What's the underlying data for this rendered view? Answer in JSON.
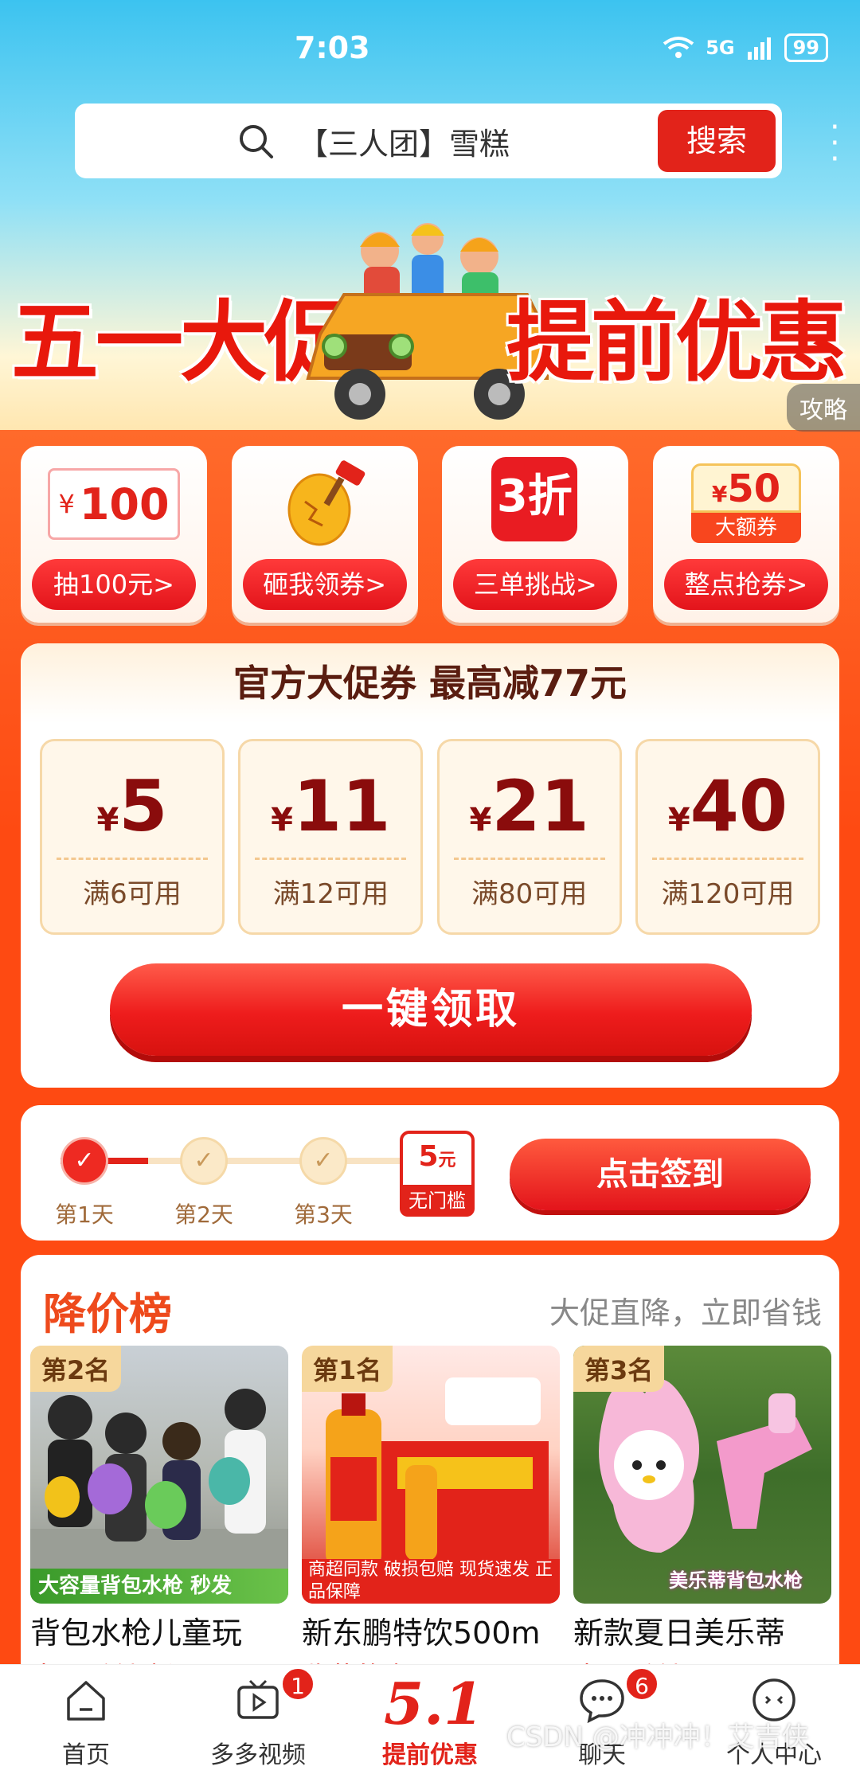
{
  "status_bar": {
    "time": "7:03",
    "signal": "5G",
    "battery": "99"
  },
  "search": {
    "query": "【三人团】雪糕",
    "button": "搜索"
  },
  "banner": {
    "left_text": "五一大促",
    "right_text": "提前优惠",
    "strategy_label": "攻略"
  },
  "features": [
    {
      "label": "抽100元>",
      "icon_amount": "100",
      "icon_currency": "¥"
    },
    {
      "label": "砸我领券>",
      "icon": "golden-egg-hammer-icon"
    },
    {
      "label": "三单挑战>",
      "icon_text": "3折"
    },
    {
      "label": "整点抢券>",
      "icon_amount": "50",
      "icon_currency": "¥",
      "icon_sub": "大额券"
    }
  ],
  "coupon_panel": {
    "title": "官方大促券 最高减77元",
    "coupons": [
      {
        "currency": "¥",
        "amount": "5",
        "condition": "满6可用"
      },
      {
        "currency": "¥",
        "amount": "11",
        "condition": "满12可用"
      },
      {
        "currency": "¥",
        "amount": "21",
        "condition": "满80可用"
      },
      {
        "currency": "¥",
        "amount": "40",
        "condition": "满120可用"
      }
    ],
    "claim_button": "一键领取"
  },
  "checkin": {
    "days": [
      {
        "label": "第1天",
        "done": true
      },
      {
        "label": "第2天",
        "done": false
      },
      {
        "label": "第3天",
        "done": false
      }
    ],
    "reward_amount": "5",
    "reward_unit": "元",
    "reward_label": "无门槛",
    "sign_button": "点击签到"
  },
  "price_drop": {
    "title": "降价榜",
    "subtitle": "大促直降，立即省钱",
    "products": [
      {
        "rank": "第2名",
        "caption": "大容量背包水枪  秒发",
        "name": "背包水枪儿童玩",
        "tag": "先用后付 新品"
      },
      {
        "rank": "第1名",
        "caption": "商超同款 破损包赔  现货速发 正品保障",
        "name": "新东鹏特饮500m",
        "tag": "收藏的商品"
      },
      {
        "rank": "第3名",
        "caption": "美乐蒂背包水枪",
        "name": "新款夏日美乐蒂",
        "tag": "先用后付"
      }
    ]
  },
  "nav": [
    {
      "label": "首页",
      "icon": "home-icon",
      "badge": ""
    },
    {
      "label": "多多视频",
      "icon": "video-icon",
      "badge": "1"
    },
    {
      "label": "提前优惠",
      "icon": "promo-51-icon",
      "badge": "",
      "active": true,
      "icon_text": "5.1"
    },
    {
      "label": "聊天",
      "icon": "chat-icon",
      "badge": "6"
    },
    {
      "label": "个人中心",
      "icon": "profile-icon",
      "badge": ""
    }
  ],
  "watermark": "CSDN @冲冲冲！艾吉侠",
  "colors": {
    "brand_red": "#e2231a",
    "orange_bg": "#fe4a12",
    "sky": "#3cc3f0"
  }
}
